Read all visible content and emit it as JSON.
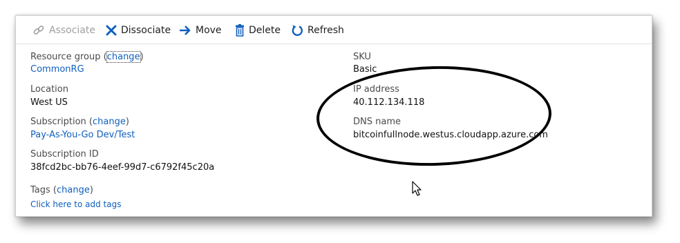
{
  "toolbar": {
    "associate": "Associate",
    "dissociate": "Dissociate",
    "move": "Move",
    "delete": "Delete",
    "refresh": "Refresh"
  },
  "left": {
    "resource_group_label": "Resource group (",
    "resource_group_change": "change",
    "resource_group_close": ")",
    "resource_group_value": "CommonRG",
    "location_label": "Location",
    "location_value": "West US",
    "subscription_label": "Subscription (",
    "subscription_change": "change",
    "subscription_close": ")",
    "subscription_value": "Pay-As-You-Go Dev/Test",
    "subscription_id_label": "Subscription ID",
    "subscription_id_value": "38fcd2bc-bb76-4eef-99d7-c6792f45c20a",
    "tags_label": "Tags (",
    "tags_change": "change",
    "tags_close": ")",
    "tags_value": "Click here to add tags"
  },
  "right": {
    "sku_label": "SKU",
    "sku_value": "Basic",
    "ip_label": "IP address",
    "ip_value": "40.112.134.118",
    "dns_label": "DNS name",
    "dns_value": "bitcoinfullnode.westus.cloudapp.azure.com"
  },
  "colors": {
    "link": "#0f5fbd",
    "accent_icon": "#0f5fbd",
    "annotation": "#000000"
  }
}
